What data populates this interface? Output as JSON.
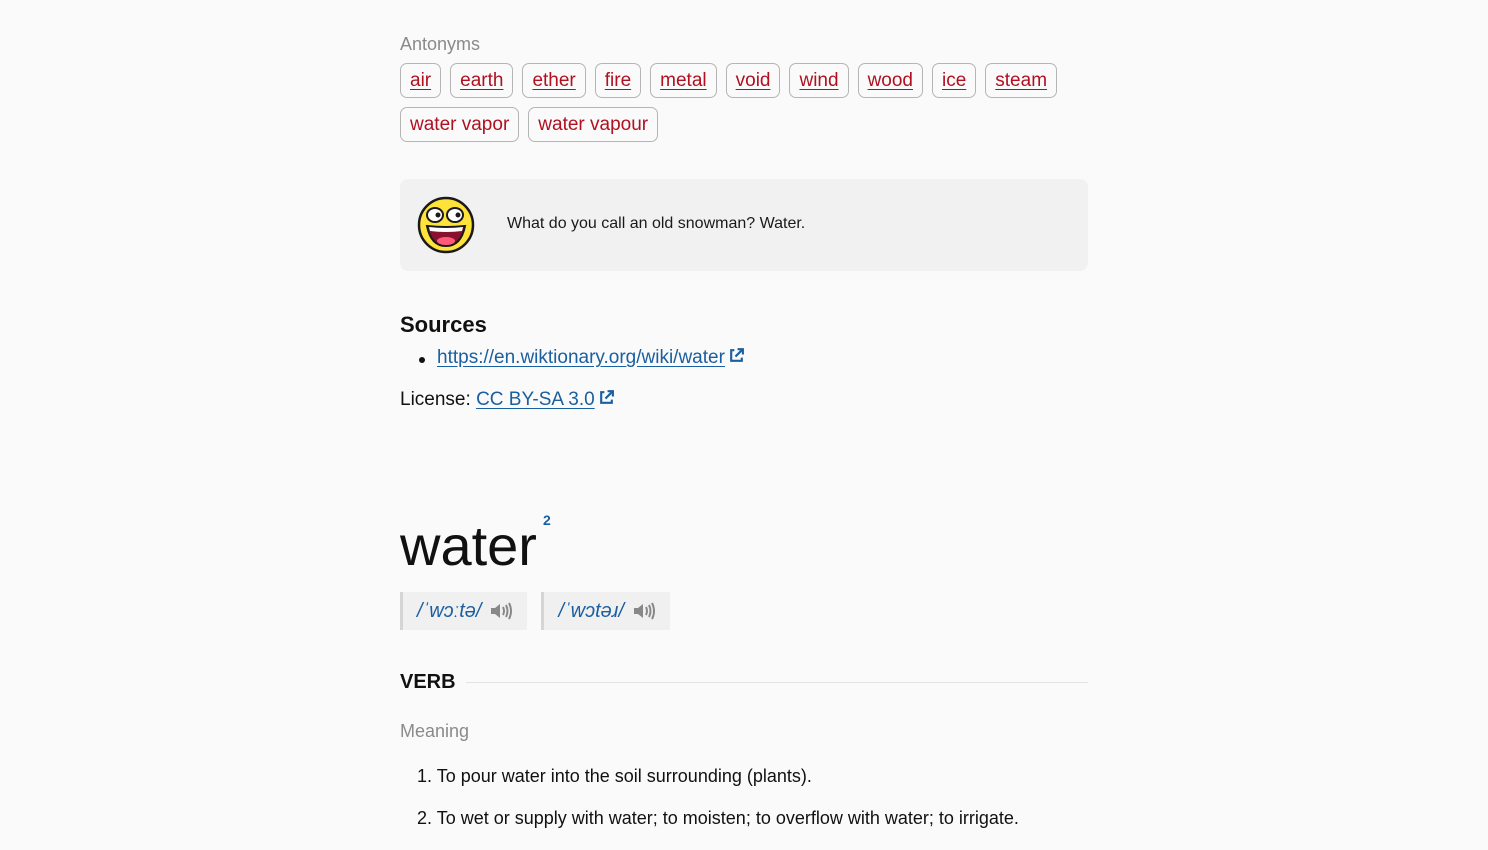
{
  "antonyms": {
    "label": "Antonyms",
    "items": [
      "air",
      "earth",
      "ether",
      "fire",
      "metal",
      "void",
      "wind",
      "wood",
      "ice",
      "steam",
      "water vapor",
      "water vapour"
    ]
  },
  "joke": {
    "icon": "laughing-face-icon",
    "text": "What do you call an old snowman? Water."
  },
  "sources": {
    "title": "Sources",
    "links": [
      "https://en.wiktionary.org/wiki/water"
    ],
    "license_label": "License:",
    "license_link": "CC BY-SA 3.0"
  },
  "entry": {
    "word": "water",
    "homograph": "2",
    "pronunciations": [
      "/ˈwɔːtə/",
      "/ˈwɔtəɹ/"
    ],
    "part_of_speech": "VERB",
    "meaning_label": "Meaning",
    "definitions": [
      "1. To pour water into the soil surrounding (plants).",
      "2. To wet or supply with water; to moisten; to overflow with water; to irrigate."
    ]
  },
  "colors": {
    "antonym_chip_text": "#b01020",
    "link": "#1a5fa0",
    "background": "#fafafa"
  }
}
